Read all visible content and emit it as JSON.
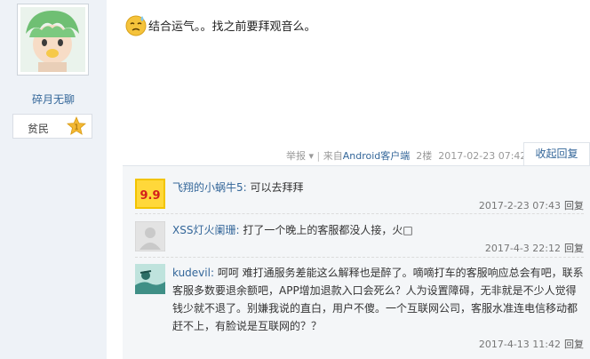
{
  "user": {
    "name": "碎月无聊",
    "rank_label": "贫民",
    "rank_badge_number": "1"
  },
  "post": {
    "text": "结合运气。。找之前要拜观音么。"
  },
  "meta": {
    "report": "举报",
    "sep": "|",
    "from_prefix": "来自",
    "client": "Android客户端",
    "floor": "2楼",
    "time": "2017-02-23 07:42",
    "reply_tab": "收起回复"
  },
  "replies": [
    {
      "user": "飞翔的小蜗牛5:",
      "content": "可以去拜拜",
      "time": "2017-2-23 07:43",
      "action": "回复",
      "avatar_text": "9.9"
    },
    {
      "user": "XSS灯火阑珊:",
      "content": "打了一个晚上的客服都没人接，火□",
      "time": "2017-4-3 22:12",
      "action": "回复"
    },
    {
      "user": "kudevil:",
      "content": "呵呵 难打通服务差能这么解释也是醉了。嘀嘀打车的客服响应总会有吧，联系客服多数要退余额吧，APP增加退款入口会死么？人为设置障碍，无非就是不少人觉得钱少就不退了。别嫌我说的直白，用户不傻。一个互联网公司，客服水准连电信移动都赶不上，有脸说是互联网的？？",
      "time": "2017-4-13 11:42",
      "action": "回复"
    }
  ],
  "colors": {
    "link": "#336699",
    "sidebar_bg": "#eef2f7",
    "reply_bg": "#f4f6f8"
  }
}
